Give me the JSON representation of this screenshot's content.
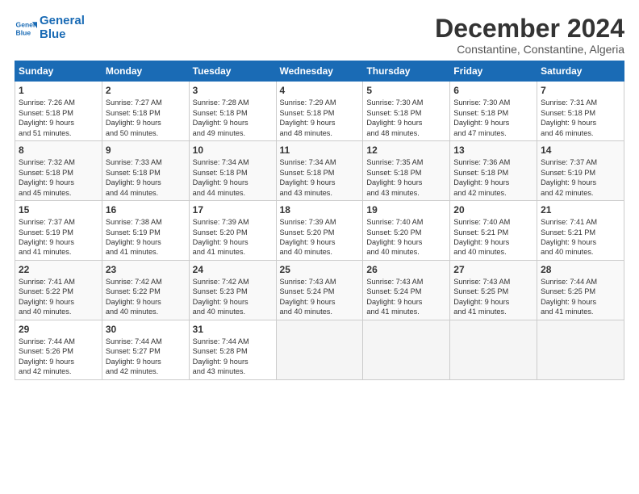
{
  "header": {
    "logo_line1": "General",
    "logo_line2": "Blue",
    "month_year": "December 2024",
    "location": "Constantine, Constantine, Algeria"
  },
  "weekdays": [
    "Sunday",
    "Monday",
    "Tuesday",
    "Wednesday",
    "Thursday",
    "Friday",
    "Saturday"
  ],
  "weeks": [
    [
      {
        "day": "1",
        "info": "Sunrise: 7:26 AM\nSunset: 5:18 PM\nDaylight: 9 hours\nand 51 minutes."
      },
      {
        "day": "2",
        "info": "Sunrise: 7:27 AM\nSunset: 5:18 PM\nDaylight: 9 hours\nand 50 minutes."
      },
      {
        "day": "3",
        "info": "Sunrise: 7:28 AM\nSunset: 5:18 PM\nDaylight: 9 hours\nand 49 minutes."
      },
      {
        "day": "4",
        "info": "Sunrise: 7:29 AM\nSunset: 5:18 PM\nDaylight: 9 hours\nand 48 minutes."
      },
      {
        "day": "5",
        "info": "Sunrise: 7:30 AM\nSunset: 5:18 PM\nDaylight: 9 hours\nand 48 minutes."
      },
      {
        "day": "6",
        "info": "Sunrise: 7:30 AM\nSunset: 5:18 PM\nDaylight: 9 hours\nand 47 minutes."
      },
      {
        "day": "7",
        "info": "Sunrise: 7:31 AM\nSunset: 5:18 PM\nDaylight: 9 hours\nand 46 minutes."
      }
    ],
    [
      {
        "day": "8",
        "info": "Sunrise: 7:32 AM\nSunset: 5:18 PM\nDaylight: 9 hours\nand 45 minutes."
      },
      {
        "day": "9",
        "info": "Sunrise: 7:33 AM\nSunset: 5:18 PM\nDaylight: 9 hours\nand 44 minutes."
      },
      {
        "day": "10",
        "info": "Sunrise: 7:34 AM\nSunset: 5:18 PM\nDaylight: 9 hours\nand 44 minutes."
      },
      {
        "day": "11",
        "info": "Sunrise: 7:34 AM\nSunset: 5:18 PM\nDaylight: 9 hours\nand 43 minutes."
      },
      {
        "day": "12",
        "info": "Sunrise: 7:35 AM\nSunset: 5:18 PM\nDaylight: 9 hours\nand 43 minutes."
      },
      {
        "day": "13",
        "info": "Sunrise: 7:36 AM\nSunset: 5:18 PM\nDaylight: 9 hours\nand 42 minutes."
      },
      {
        "day": "14",
        "info": "Sunrise: 7:37 AM\nSunset: 5:19 PM\nDaylight: 9 hours\nand 42 minutes."
      }
    ],
    [
      {
        "day": "15",
        "info": "Sunrise: 7:37 AM\nSunset: 5:19 PM\nDaylight: 9 hours\nand 41 minutes."
      },
      {
        "day": "16",
        "info": "Sunrise: 7:38 AM\nSunset: 5:19 PM\nDaylight: 9 hours\nand 41 minutes."
      },
      {
        "day": "17",
        "info": "Sunrise: 7:39 AM\nSunset: 5:20 PM\nDaylight: 9 hours\nand 41 minutes."
      },
      {
        "day": "18",
        "info": "Sunrise: 7:39 AM\nSunset: 5:20 PM\nDaylight: 9 hours\nand 40 minutes."
      },
      {
        "day": "19",
        "info": "Sunrise: 7:40 AM\nSunset: 5:20 PM\nDaylight: 9 hours\nand 40 minutes."
      },
      {
        "day": "20",
        "info": "Sunrise: 7:40 AM\nSunset: 5:21 PM\nDaylight: 9 hours\nand 40 minutes."
      },
      {
        "day": "21",
        "info": "Sunrise: 7:41 AM\nSunset: 5:21 PM\nDaylight: 9 hours\nand 40 minutes."
      }
    ],
    [
      {
        "day": "22",
        "info": "Sunrise: 7:41 AM\nSunset: 5:22 PM\nDaylight: 9 hours\nand 40 minutes."
      },
      {
        "day": "23",
        "info": "Sunrise: 7:42 AM\nSunset: 5:22 PM\nDaylight: 9 hours\nand 40 minutes."
      },
      {
        "day": "24",
        "info": "Sunrise: 7:42 AM\nSunset: 5:23 PM\nDaylight: 9 hours\nand 40 minutes."
      },
      {
        "day": "25",
        "info": "Sunrise: 7:43 AM\nSunset: 5:24 PM\nDaylight: 9 hours\nand 40 minutes."
      },
      {
        "day": "26",
        "info": "Sunrise: 7:43 AM\nSunset: 5:24 PM\nDaylight: 9 hours\nand 41 minutes."
      },
      {
        "day": "27",
        "info": "Sunrise: 7:43 AM\nSunset: 5:25 PM\nDaylight: 9 hours\nand 41 minutes."
      },
      {
        "day": "28",
        "info": "Sunrise: 7:44 AM\nSunset: 5:25 PM\nDaylight: 9 hours\nand 41 minutes."
      }
    ],
    [
      {
        "day": "29",
        "info": "Sunrise: 7:44 AM\nSunset: 5:26 PM\nDaylight: 9 hours\nand 42 minutes."
      },
      {
        "day": "30",
        "info": "Sunrise: 7:44 AM\nSunset: 5:27 PM\nDaylight: 9 hours\nand 42 minutes."
      },
      {
        "day": "31",
        "info": "Sunrise: 7:44 AM\nSunset: 5:28 PM\nDaylight: 9 hours\nand 43 minutes."
      },
      null,
      null,
      null,
      null
    ]
  ]
}
